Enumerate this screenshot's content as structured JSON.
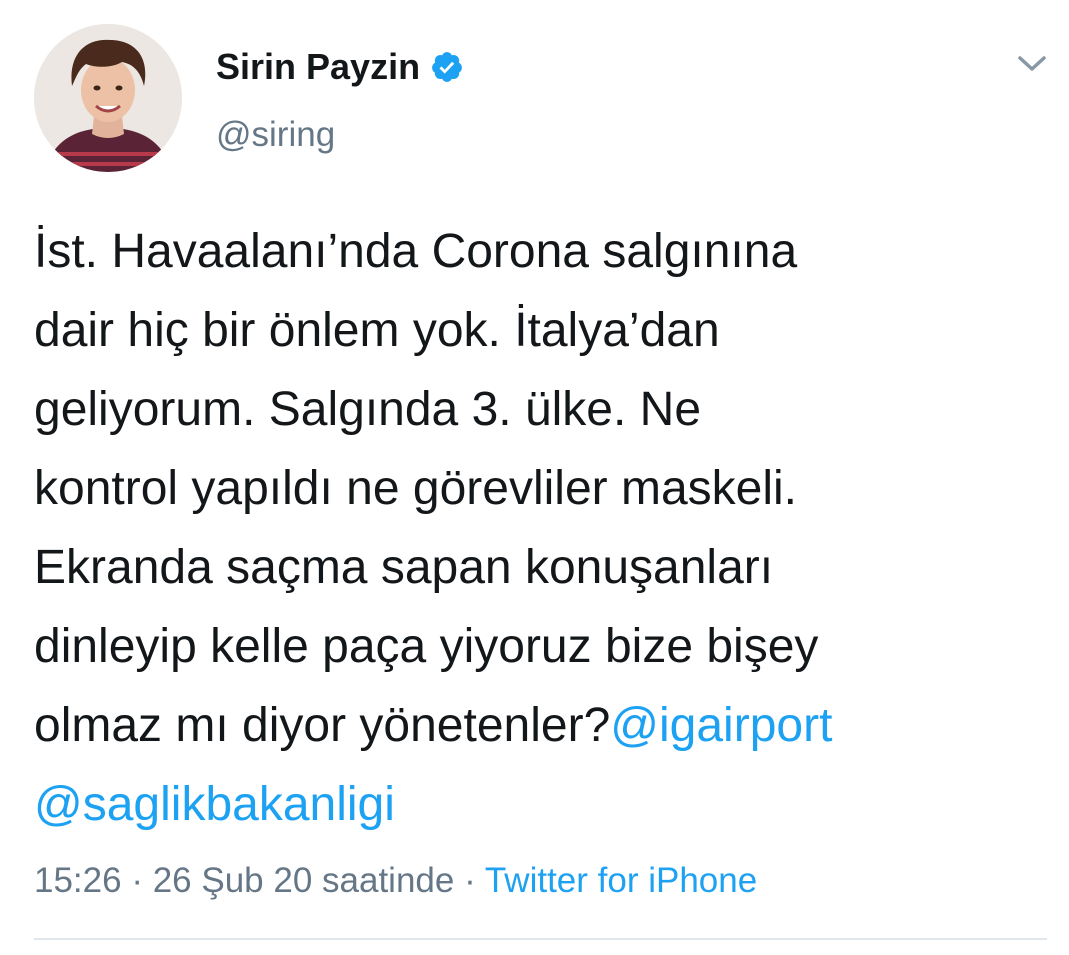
{
  "author": {
    "display_name": "Sirin Payzin",
    "handle": "@siring",
    "verified": true
  },
  "tweet": {
    "lines": [
      "İst. Havaalanı’nda Corona salgınına",
      "dair hiç bir önlem yok. İtalya’dan",
      "geliyorum. Salgında 3. ülke. Ne",
      "kontrol yapıldı ne görevliler maskeli.",
      "Ekranda saçma sapan konuşanları",
      "dinleyip kelle paça yiyoruz bize bişey",
      "olmaz mı diyor yönetenler?"
    ],
    "mentions": [
      "@igairport",
      "@saglikbakanligi"
    ]
  },
  "meta": {
    "time": "15:26",
    "separator": "·",
    "date": "26 Şub 20 saatinde",
    "source": "Twitter for iPhone"
  },
  "icons": {
    "verified": "verified-badge-icon",
    "menu": "chevron-down-icon"
  },
  "colors": {
    "link": "#1da1f2",
    "text": "#14171a",
    "secondary": "#657786",
    "divider": "#e1e8ed"
  }
}
